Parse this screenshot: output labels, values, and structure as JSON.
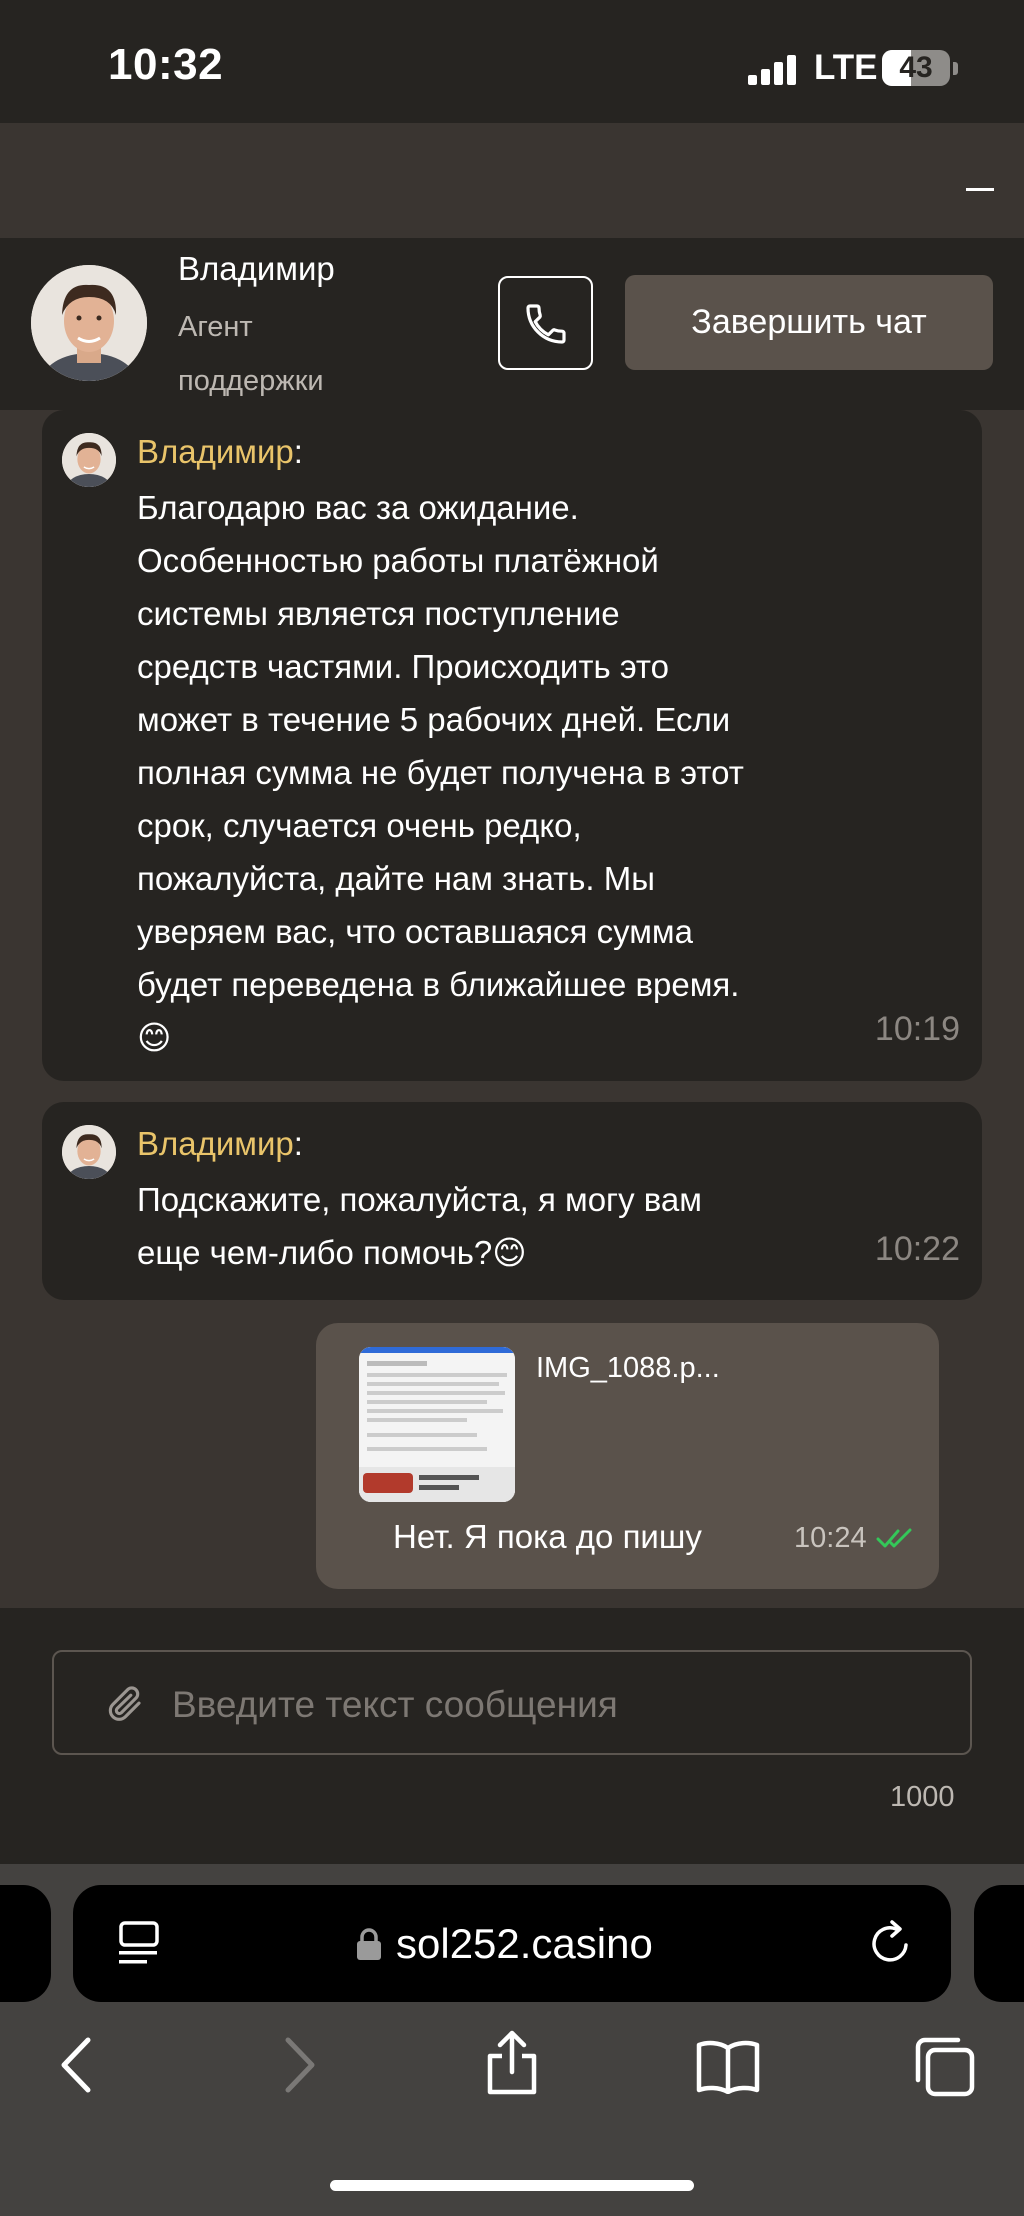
{
  "status_bar": {
    "time": "10:32",
    "network": "LTE",
    "battery": "43",
    "battery_level": 0.43
  },
  "chat_header": {
    "agent_name": "Владимир",
    "agent_role": "Агент поддержки",
    "end_chat_label": "Завершить чат"
  },
  "messages": [
    {
      "sender": "Владимир",
      "lines": [
        "Благодарю вас за ожидание.",
        "Особенностью работы платёжной",
        "системы является поступление",
        "средств частями. Происходить это",
        "может в течение 5 рабочих дней. Если",
        "полная сумма не будет получена в этот",
        "срок, случается очень редко,",
        "пожалуйста, дайте нам знать. Мы",
        "уверяем вас, что оставшаяся сумма",
        "будет переведена в ближайшее время.",
        "😊"
      ],
      "time": "10:19"
    },
    {
      "sender": "Владимир",
      "lines": [
        "Подскажите, пожалуйста, я могу вам",
        "еще чем-либо помочь?😊"
      ],
      "time": "10:22"
    }
  ],
  "outgoing": {
    "attachment_name": "IMG_1088.p...",
    "text": "Нет. Я пока до пишу",
    "time": "10:24",
    "status_color": "#34c759"
  },
  "composer": {
    "placeholder": "Введите текст сообщения",
    "char_counter": "1000"
  },
  "browser": {
    "url": "sol252.casino"
  },
  "colors": {
    "accent_name": "#e9c46a",
    "panel_dark": "#262421",
    "panel_mid": "#3a3531",
    "bubble_out": "#5a524b"
  }
}
